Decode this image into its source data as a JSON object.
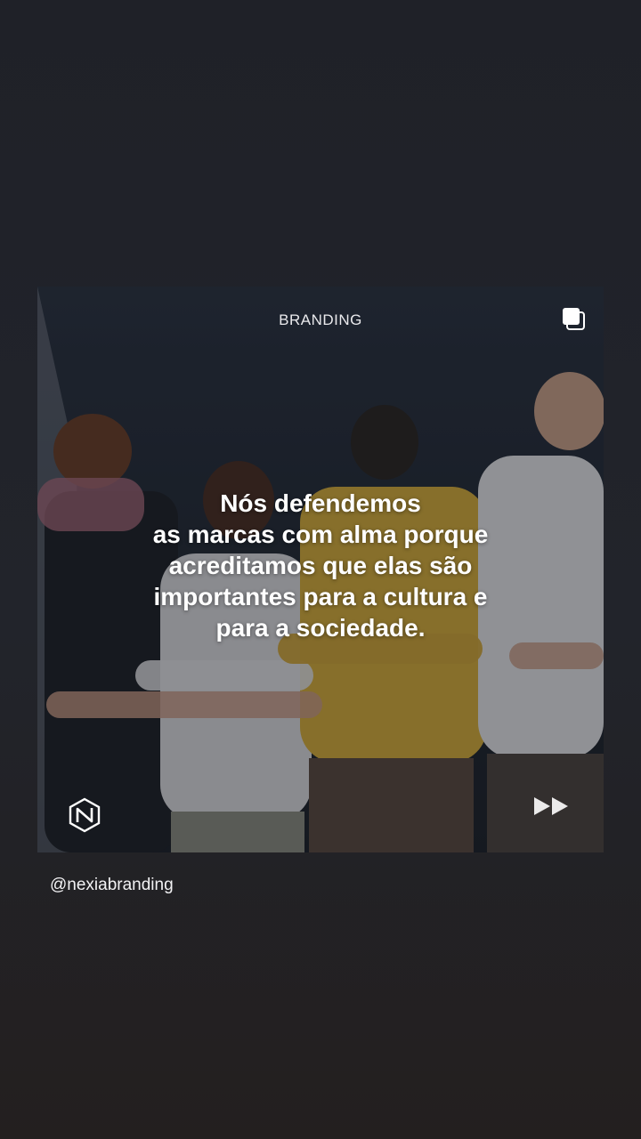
{
  "post": {
    "category": "BRANDING",
    "headline_lines": [
      "Nós defendemos",
      "as marcas com alma porque",
      "acreditamos que elas são",
      "importantes para a cultura e",
      "para a sociedade."
    ],
    "icons": {
      "carousel": "carousel-stack-icon",
      "brand": "nexia-logo-icon",
      "next": "fast-forward-icon"
    }
  },
  "story": {
    "handle": "@nexiabranding"
  },
  "colors": {
    "background": "#202229",
    "text": "#ffffff",
    "jacket_accent": "#d4ac3a"
  }
}
